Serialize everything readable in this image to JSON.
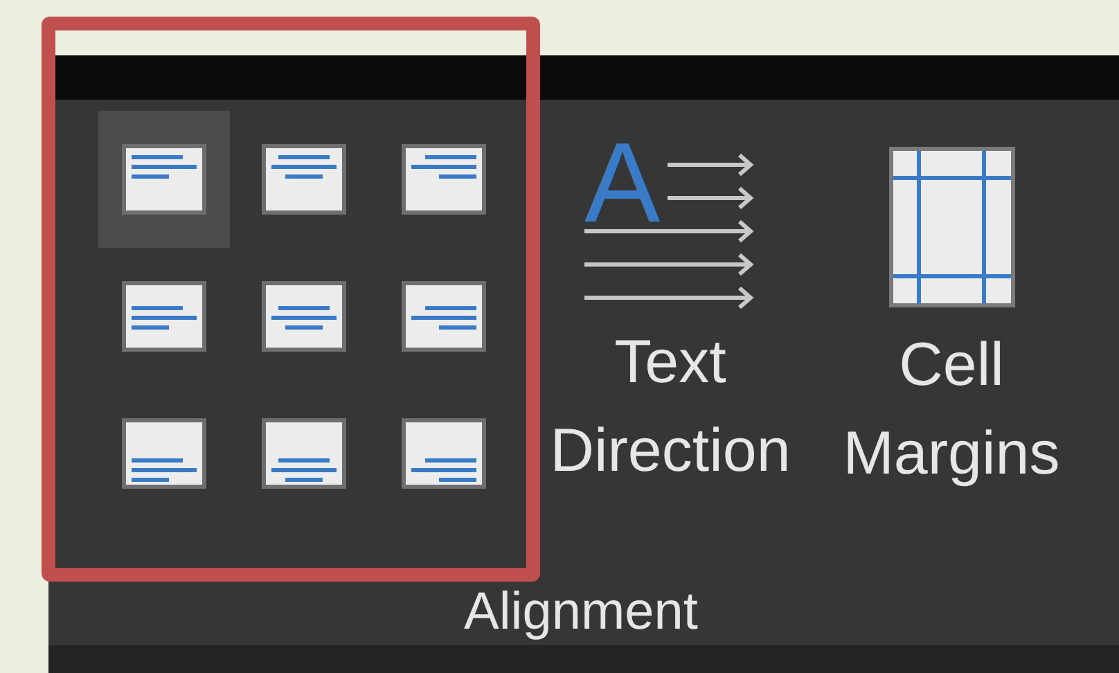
{
  "alignment_buttons": [
    {
      "selected": true
    },
    {
      "selected": false
    },
    {
      "selected": false
    },
    {
      "selected": false
    },
    {
      "selected": false
    },
    {
      "selected": false
    },
    {
      "selected": false
    },
    {
      "selected": false
    },
    {
      "selected": false
    }
  ],
  "large_buttons": [
    {
      "kind": "direction",
      "icon_letter": "A",
      "lines": [
        "Text",
        "Direction"
      ]
    },
    {
      "kind": "margins",
      "lines": [
        "Cell",
        "Margins"
      ]
    }
  ],
  "group_label": "Alignment"
}
